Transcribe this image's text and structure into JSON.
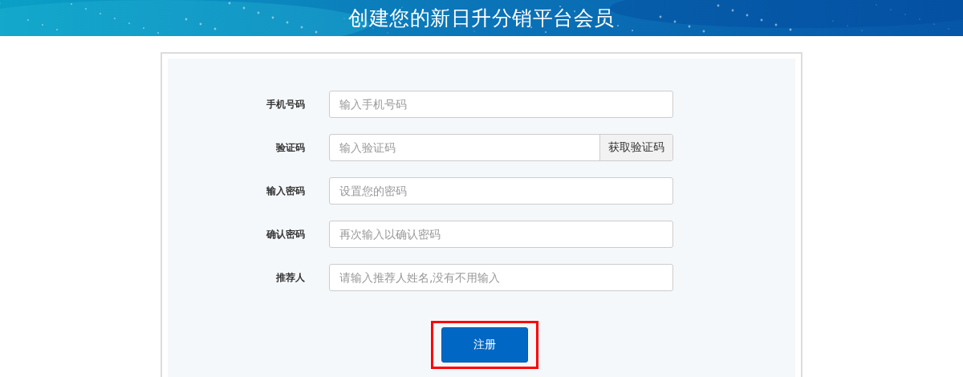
{
  "header": {
    "title": "创建您的新日升分销平台会员"
  },
  "form": {
    "fields": [
      {
        "label": "手机号码",
        "placeholder": "输入手机号码"
      },
      {
        "label": "验证码",
        "placeholder": "输入验证码",
        "addon_button": "获取验证码"
      },
      {
        "label": "输入密码",
        "placeholder": "设置您的密码"
      },
      {
        "label": "确认密码",
        "placeholder": "再次输入以确认密码"
      },
      {
        "label": "推荐人",
        "placeholder": "请输入推荐人姓名,没有不用输入"
      }
    ],
    "submit": {
      "label": "注册",
      "highlighted": true
    }
  }
}
